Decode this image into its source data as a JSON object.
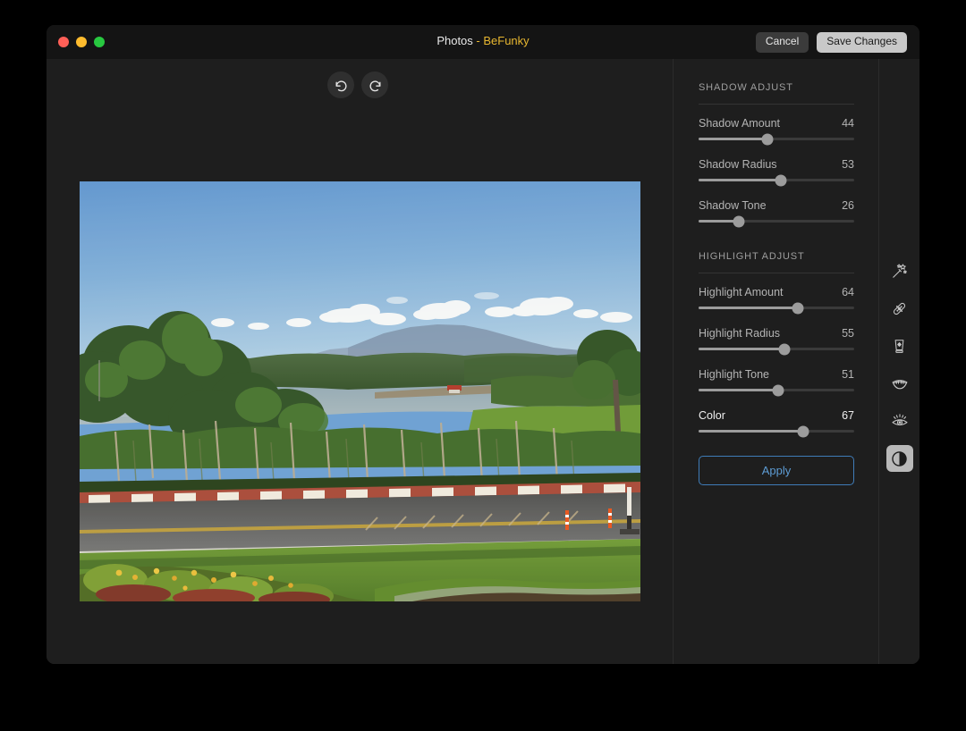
{
  "window": {
    "title_app": "Photos",
    "title_sep": " - ",
    "title_brand": "BeFunky",
    "traffic_lights": [
      "close-button",
      "minimize-button",
      "zoom-button"
    ]
  },
  "titlebar_actions": {
    "cancel_label": "Cancel",
    "save_label": "Save Changes"
  },
  "history": {
    "undo_label": "Undo",
    "redo_label": "Redo"
  },
  "panel": {
    "sections": [
      {
        "heading": "SHADOW ADJUST",
        "sliders": [
          {
            "label": "Shadow Amount",
            "value": 44,
            "active": false
          },
          {
            "label": "Shadow Radius",
            "value": 53,
            "active": false
          },
          {
            "label": "Shadow Tone",
            "value": 26,
            "active": false
          }
        ]
      },
      {
        "heading": "HIGHLIGHT ADJUST",
        "sliders": [
          {
            "label": "Highlight Amount",
            "value": 64,
            "active": false
          },
          {
            "label": "Highlight Radius",
            "value": 55,
            "active": false
          },
          {
            "label": "Highlight Tone",
            "value": 51,
            "active": false
          },
          {
            "label": "Color",
            "value": 67,
            "active": true
          }
        ]
      }
    ],
    "apply_label": "Apply",
    "slider_min": 0,
    "slider_max": 100
  },
  "tool_rail": {
    "tools": [
      {
        "name": "magic-wand-icon",
        "selected": false
      },
      {
        "name": "blemish-fix-icon",
        "selected": false
      },
      {
        "name": "skin-smoother-icon",
        "selected": false
      },
      {
        "name": "teeth-whiten-icon",
        "selected": false
      },
      {
        "name": "eye-brighten-icon",
        "selected": false
      },
      {
        "name": "contrast-icon",
        "selected": true
      }
    ]
  },
  "photo": {
    "name": "landscape-lake-road-photo",
    "description": "Sunny landscape: blue sky with scattered white clouds, forested hills, a lake with a small boat and a red-roofed building, distant blue mountains, an asphalt road with red-and-white painted curb, orange bollards, green lawns and a flower bed in the foreground",
    "colors": {
      "sky_top": "#5f97d4",
      "sky_bottom": "#a9cbe6",
      "mountain": "#7d93ae",
      "forest": "#3c5c31",
      "lake": "#8ba6b4",
      "road": "#5b5d5e",
      "grass": "#5f8a32",
      "curb_red": "#b24a3e"
    }
  },
  "theme": {
    "window_bg": "#212121",
    "titlebar_bg": "#141414",
    "panel_bg": "#1e1e1e",
    "accent_brand": "#e8b730",
    "accent_blue": "#5d9cd4",
    "slider_fill": "#9c9c9c",
    "slider_track": "#3a3a3a"
  }
}
